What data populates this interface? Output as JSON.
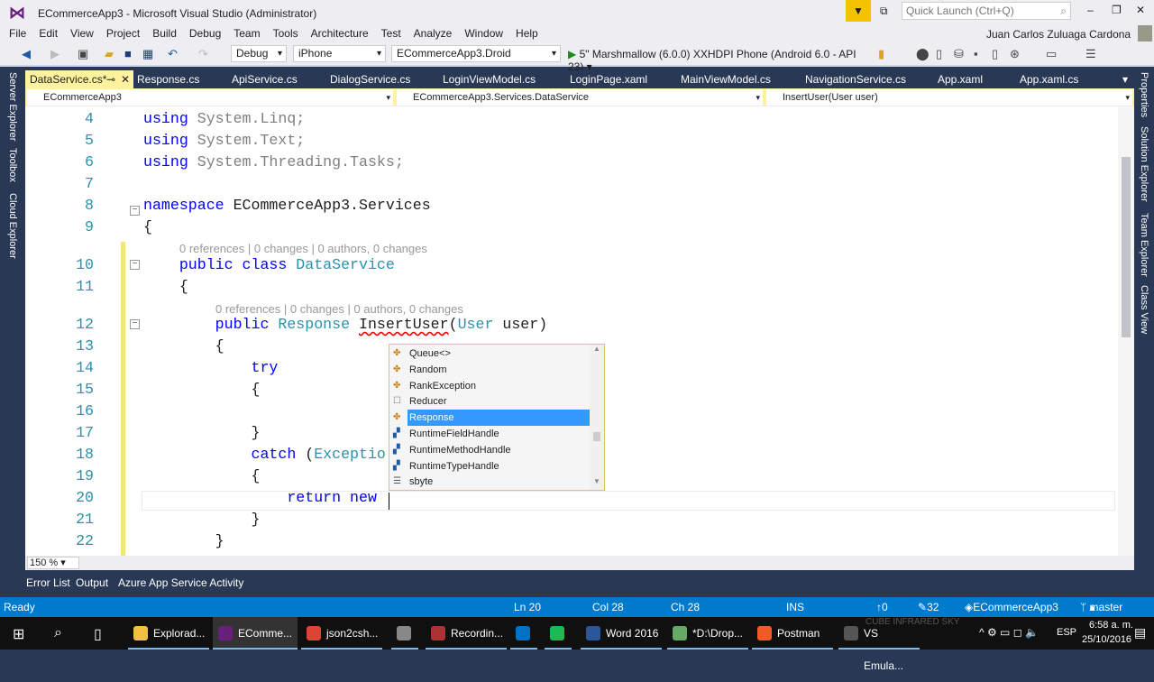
{
  "window": {
    "title": "ECommerceApp3 - Microsoft Visual Studio (Administrator)",
    "quick_launch_placeholder": "Quick Launch (Ctrl+Q)",
    "user": "Juan Carlos Zuluaga Cardona"
  },
  "menu": [
    "File",
    "Edit",
    "View",
    "Project",
    "Build",
    "Debug",
    "Team",
    "Tools",
    "Architecture",
    "Test",
    "Analyze",
    "Window",
    "Help"
  ],
  "toolbar": {
    "configuration": "Debug",
    "platform": "iPhone",
    "startup_project": "ECommerceApp3.Droid",
    "device": "5\" Marshmallow (6.0.0) XXHDPI Phone (Android 6.0 - API 23)"
  },
  "tabs": [
    "DataService.cs*",
    "Response.cs",
    "ApiService.cs",
    "DialogService.cs",
    "LoginViewModel.cs",
    "LoginPage.xaml",
    "MainViewModel.cs",
    "NavigationService.cs",
    "App.xaml",
    "App.xaml.cs"
  ],
  "navbar": {
    "project": "ECommerceApp3",
    "type": "ECommerceApp3.Services.DataService",
    "member": "InsertUser(User user)"
  },
  "left_panels": [
    "Server Explorer",
    "Toolbox",
    "Cloud Explorer"
  ],
  "right_panels": [
    "Properties",
    "Solution Explorer",
    "Team Explorer",
    "Class View"
  ],
  "code": {
    "lines": [
      {
        "n": "4",
        "parts": [
          [
            "kw",
            "using "
          ],
          [
            "gr",
            "System.Linq;"
          ]
        ]
      },
      {
        "n": "5",
        "parts": [
          [
            "kw",
            "using "
          ],
          [
            "gr",
            "System.Text;"
          ]
        ]
      },
      {
        "n": "6",
        "parts": [
          [
            "kw",
            "using "
          ],
          [
            "gr",
            "System.Threading.Tasks;"
          ]
        ]
      },
      {
        "n": "7",
        "parts": []
      },
      {
        "n": "8",
        "parts": [
          [
            "kw",
            "namespace "
          ],
          [
            "",
            "ECommerceApp3.Services"
          ]
        ]
      },
      {
        "n": "9",
        "parts": [
          [
            "",
            "{"
          ]
        ]
      },
      {
        "n": "10",
        "parts": [
          [
            "",
            "    "
          ],
          [
            "kw",
            "public class "
          ],
          [
            "ty",
            "DataService"
          ]
        ]
      },
      {
        "n": "11",
        "parts": [
          [
            "",
            "    {"
          ]
        ]
      },
      {
        "n": "12",
        "parts": [
          [
            "",
            "        "
          ],
          [
            "kw",
            "public "
          ],
          [
            "ty",
            "Response "
          ],
          [
            "sq",
            "InsertUser"
          ],
          [
            "",
            "("
          ],
          [
            "ty",
            "User"
          ],
          [
            "",
            " user)"
          ]
        ]
      },
      {
        "n": "13",
        "parts": [
          [
            "",
            "        {"
          ]
        ]
      },
      {
        "n": "14",
        "parts": [
          [
            "",
            "            "
          ],
          [
            "kw",
            "try"
          ]
        ]
      },
      {
        "n": "15",
        "parts": [
          [
            "",
            "            {"
          ]
        ]
      },
      {
        "n": "16",
        "parts": []
      },
      {
        "n": "17",
        "parts": [
          [
            "",
            "            }"
          ]
        ]
      },
      {
        "n": "18",
        "parts": [
          [
            "",
            "            "
          ],
          [
            "kw",
            "catch "
          ],
          [
            "",
            "("
          ],
          [
            "ty",
            "Exceptio"
          ]
        ]
      },
      {
        "n": "19",
        "parts": [
          [
            "",
            "            {"
          ]
        ]
      },
      {
        "n": "20",
        "parts": [
          [
            "",
            "                "
          ],
          [
            "kw",
            "return new "
          ]
        ]
      },
      {
        "n": "21",
        "parts": [
          [
            "",
            "            }"
          ]
        ]
      },
      {
        "n": "22",
        "parts": [
          [
            "",
            "        }"
          ]
        ]
      }
    ],
    "codelens": "0 references | 0 changes | 0 authors, 0 changes"
  },
  "completion": {
    "items": [
      {
        "label": "Queue<>",
        "icon": "class-icon"
      },
      {
        "label": "Random",
        "icon": "class-icon"
      },
      {
        "label": "RankException",
        "icon": "class-icon"
      },
      {
        "label": "Reducer",
        "icon": "module-icon"
      },
      {
        "label": "Response",
        "icon": "class-icon",
        "selected": true
      },
      {
        "label": "RuntimeFieldHandle",
        "icon": "struct-icon"
      },
      {
        "label": "RuntimeMethodHandle",
        "icon": "struct-icon"
      },
      {
        "label": "RuntimeTypeHandle",
        "icon": "struct-icon"
      },
      {
        "label": "sbyte",
        "icon": "keyword-icon"
      }
    ]
  },
  "zoom": "150 %",
  "bottom_tabs": [
    "Error List",
    "Output",
    "Azure App Service Activity"
  ],
  "status": {
    "state": "Ready",
    "ln": "Ln 20",
    "col": "Col 28",
    "ch": "Ch 28",
    "mode": "INS",
    "up": "0",
    "pending": "32",
    "repo": "ECommerceApp3",
    "branch": "master"
  },
  "taskbar": {
    "apps": [
      "Explorad...",
      "EComme...",
      "json2csh...",
      "",
      "Recordin...",
      "",
      "",
      "Word 2016",
      "*D:\\Drop...",
      "Postman",
      "VS Emula..."
    ],
    "lang": "ESP",
    "time": "6:58 a. m.",
    "date": "25/10/2016",
    "overlay": "CUBE INFRARED SKY"
  },
  "colors": {
    "accent": "#007acc",
    "active_tab": "#fff29d",
    "selection": "#3399ff",
    "frame": "#293955"
  }
}
